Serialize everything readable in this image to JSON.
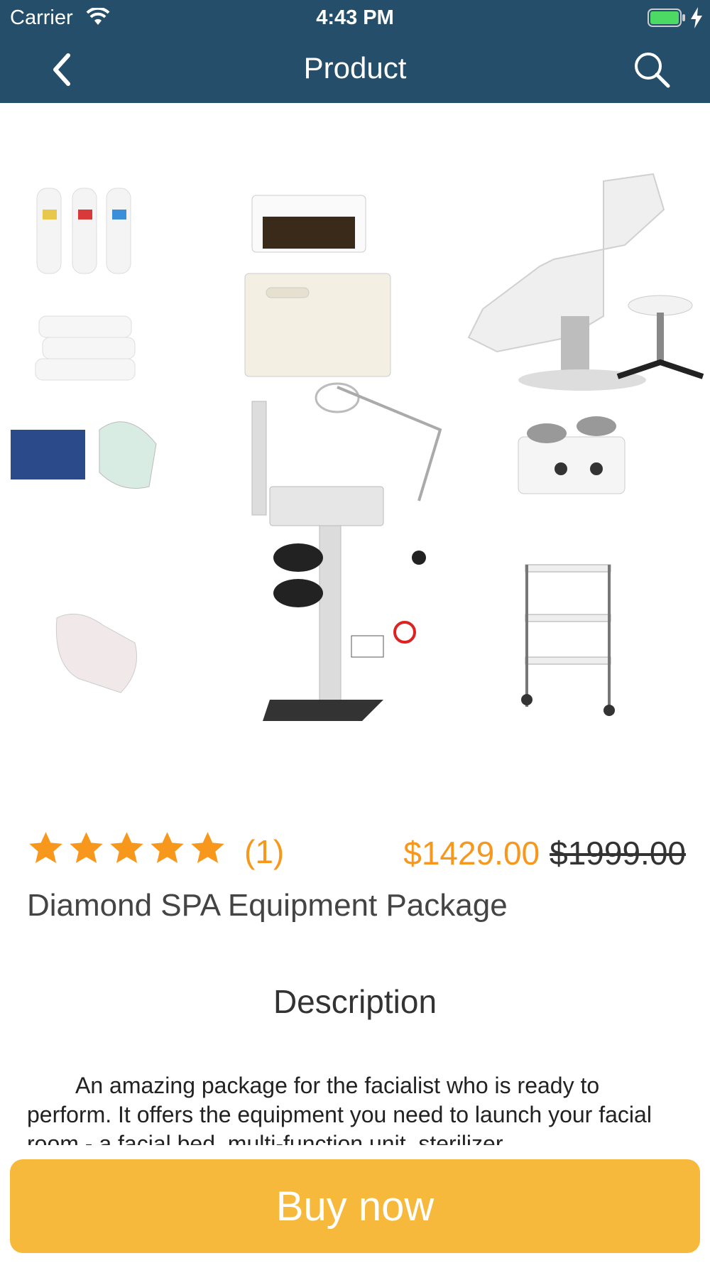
{
  "status_bar": {
    "carrier": "Carrier",
    "time": "4:43 PM",
    "battery_color": "#4cd964"
  },
  "nav": {
    "title": "Product",
    "back_icon": "chevron-left-icon",
    "search_icon": "search-icon"
  },
  "product": {
    "image_icon": "product-photo",
    "rating": 5,
    "rating_max": 5,
    "review_count": "(1)",
    "price": "$1429.00",
    "old_price": "$1999.00",
    "name": "Diamond SPA Equipment Package"
  },
  "description": {
    "title": "Description",
    "text": "An amazing package for the facialist who is ready to perform. It offers the equipment you need to launch your facial room - a facial bed, multi-function unit, sterilizer"
  },
  "buy_button": {
    "label": "Buy now"
  },
  "colors": {
    "header": "#244e69",
    "accent": "#f7981d",
    "button": "#f6b93b"
  }
}
